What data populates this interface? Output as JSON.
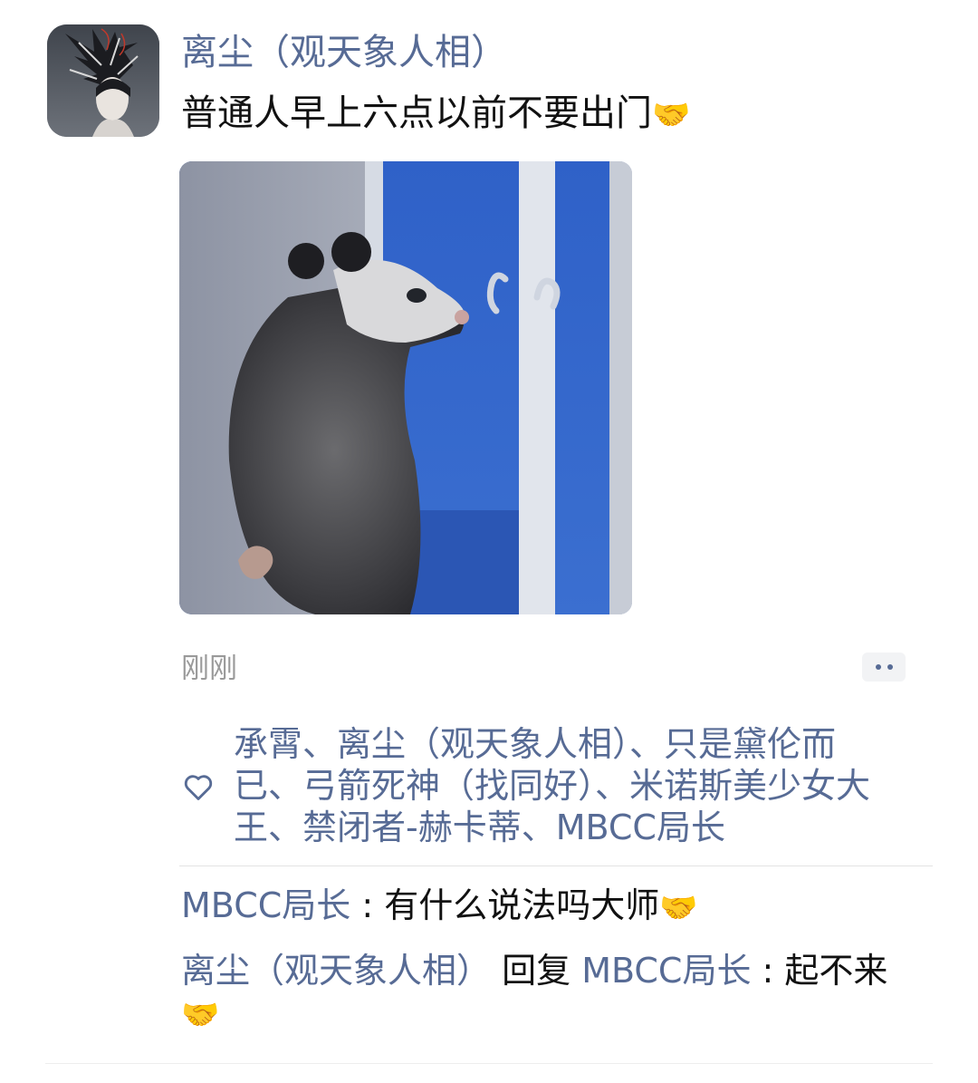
{
  "post": {
    "author_name": "离尘（观天象人相）",
    "text": "普通人早上六点以前不要出门",
    "text_emoji": "🤝",
    "timestamp": "刚刚",
    "image_icon": "opossum-at-window-photo"
  },
  "likes": {
    "icon": "heart-icon",
    "lines": [
      "承霄、离尘（观天象人相）、只是黛伦而",
      "已、弓箭死神（找同好）、米诺斯美少女大",
      "王、禁闭者-赫卡蒂、MBCC局长"
    ]
  },
  "comments": [
    {
      "author": "MBCC局长",
      "separator": " : ",
      "text": "有什么说法吗大师",
      "emoji": "🤝"
    },
    {
      "author": "离尘（观天象人相）",
      "reply_word": " 回复 ",
      "reply_to": "MBCC局长",
      "separator": " : ",
      "text": "起不来",
      "emoji": "🤝"
    }
  ],
  "colors": {
    "link_blue": "#576b95",
    "text": "#111111",
    "muted": "#9a9a9a",
    "panel": "#f2f3f5"
  }
}
